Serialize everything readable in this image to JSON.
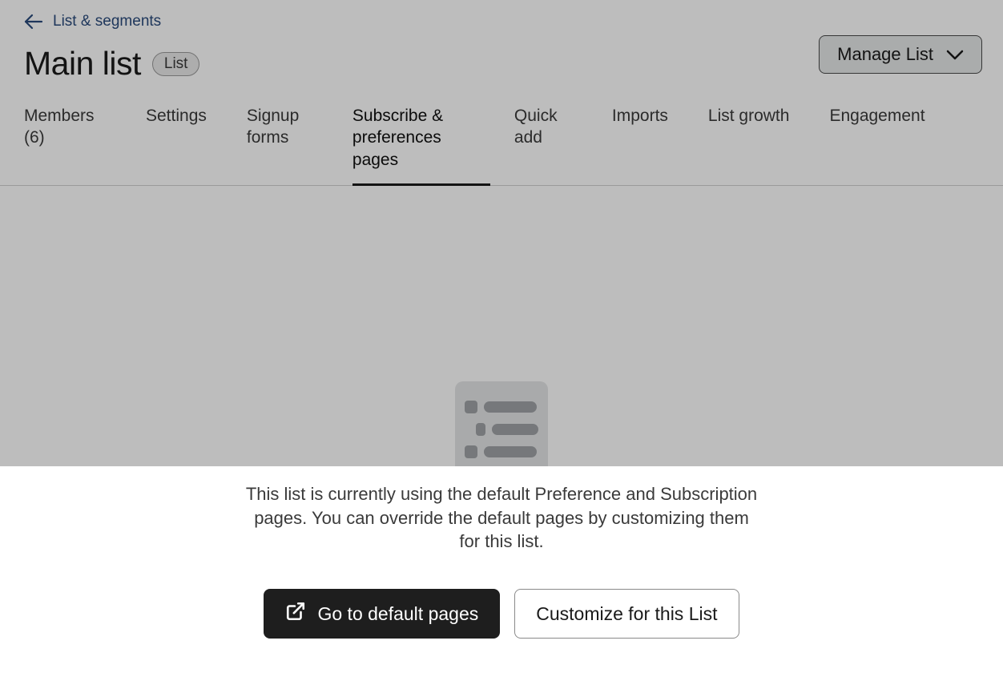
{
  "breadcrumb": {
    "label": "List & segments"
  },
  "title": "Main list",
  "badge": "List",
  "manage_button": "Manage List",
  "tabs": [
    {
      "label": "Members (6)"
    },
    {
      "label": "Settings"
    },
    {
      "label": "Signup forms"
    },
    {
      "label": "Subscribe & preferences pages",
      "active": true
    },
    {
      "label": "Quick add"
    },
    {
      "label": "Imports"
    },
    {
      "label": "List growth"
    },
    {
      "label": "Engagement"
    }
  ],
  "description": "This list is currently using the default Preference and Subscription pages. You can override the default pages by customizing them for this list.",
  "buttons": {
    "primary": "Go to default pages",
    "secondary": "Customize for this List"
  }
}
